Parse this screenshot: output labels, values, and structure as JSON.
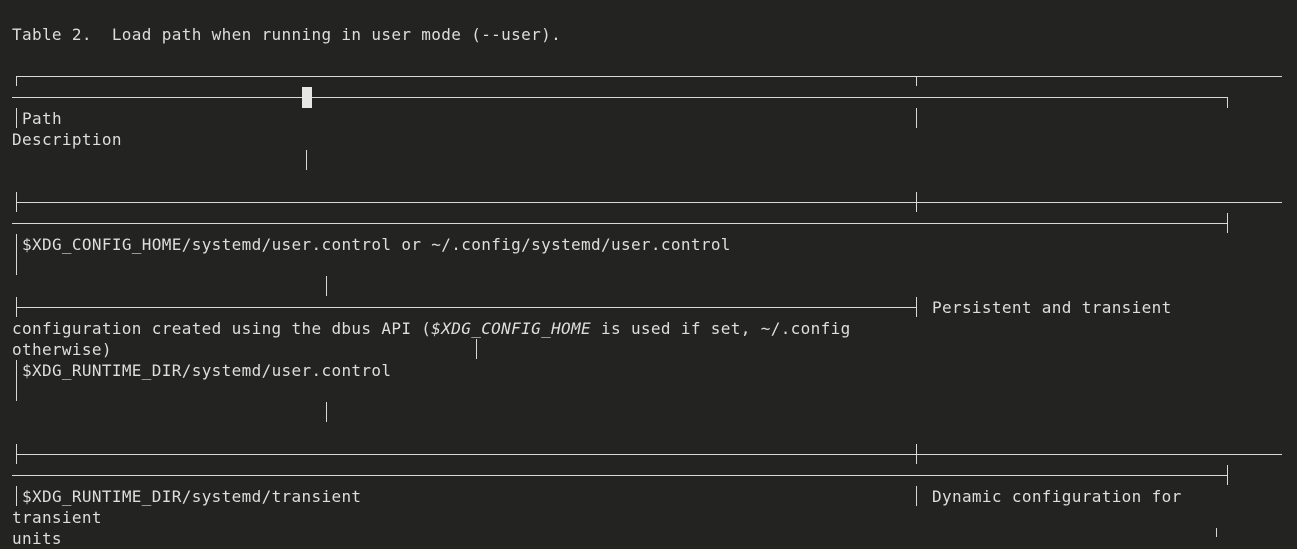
{
  "colors": {
    "background": "#232321",
    "foreground": "#dedede",
    "rule": "#d9d9d9",
    "cursor": "#e6e6e6"
  },
  "table": {
    "caption": "Table 2.  Load path when running in user mode (--user).",
    "headers": {
      "path": "Path",
      "description": "Description"
    },
    "rows": [
      {
        "path": "$XDG_CONFIG_HOME/systemd/user.control or ~/.config/systemd/user.control",
        "description_line1": "Persistent and transient",
        "description_line2_prefix": "configuration created using the dbus API (",
        "description_line2_italic": "$XDG_CONFIG_HOME",
        "description_line2_suffix": " is used if set, ~/.config",
        "description_line3": "otherwise)"
      },
      {
        "path": "$XDG_RUNTIME_DIR/systemd/user.control"
      },
      {
        "path": "$XDG_RUNTIME_DIR/systemd/transient",
        "description_line1": "Dynamic configuration for",
        "description_line2": "transient",
        "description_line3": "units"
      }
    ]
  }
}
